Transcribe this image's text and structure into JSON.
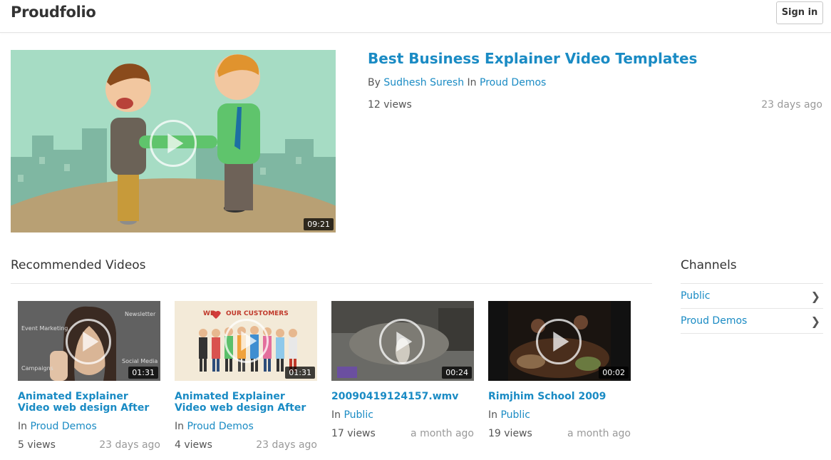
{
  "header": {
    "brand": "Proudfolio",
    "signin_label": "Sign in"
  },
  "featured": {
    "title": "Best Business Explainer Video Templates",
    "by_prefix": "By",
    "author": "Sudhesh Suresh",
    "in_prefix": "In",
    "channel": "Proud Demos",
    "views": "12 views",
    "age": "23 days ago",
    "duration": "09:21"
  },
  "recommended": {
    "heading": "Recommended Videos",
    "videos": [
      {
        "title": "Animated Explainer Video web design After Effect...",
        "in_prefix": "In",
        "channel": "Proud Demos",
        "views": "5 views",
        "age": "23 days ago",
        "duration": "01:31",
        "thumb_words": [
          "Newsletter",
          "Event Marketing",
          "Social Media",
          "Campaigns"
        ]
      },
      {
        "title": "Animated Explainer Video web design After Effect...",
        "in_prefix": "In",
        "channel": "Proud Demos",
        "views": "4 views",
        "age": "23 days ago",
        "duration": "01:31",
        "thumb_words": [
          "WE",
          "OUR CUSTOMERS"
        ]
      },
      {
        "title": "20090419124157.wmv",
        "in_prefix": "In",
        "channel": "Public",
        "views": "17 views",
        "age": "a month ago",
        "duration": "00:24"
      },
      {
        "title": "Rimjhim School 2009",
        "in_prefix": "In",
        "channel": "Public",
        "views": "19 views",
        "age": "a month ago",
        "duration": "00:02"
      }
    ]
  },
  "channels": {
    "heading": "Channels",
    "items": [
      {
        "label": "Public",
        "icon": "chevron-right-icon"
      },
      {
        "label": "Proud Demos",
        "icon": "chevron-right-icon"
      }
    ]
  },
  "colors": {
    "link": "#1a8bc4",
    "muted": "#999999"
  }
}
